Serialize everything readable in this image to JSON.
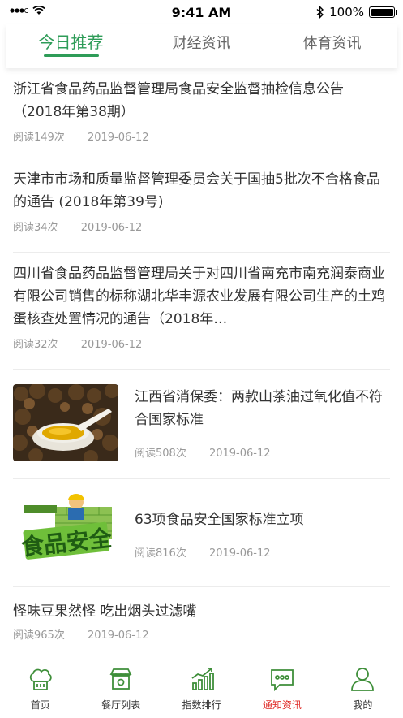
{
  "status": {
    "time": "9:41 AM",
    "battery": "100%"
  },
  "tabs": [
    {
      "label": "今日推荐"
    },
    {
      "label": "财经资讯"
    },
    {
      "label": "体育资讯"
    }
  ],
  "articles": [
    {
      "title": "浙江省食品药品监督管理局食品安全监督抽检信息公告（2018年第38期）",
      "reads": "阅读149次",
      "date": "2019-06-12"
    },
    {
      "title": "天津市市场和质量监督管理委员会关于国抽5批次不合格食品的通告 (2018年第39号)",
      "reads": "阅读34次",
      "date": "2019-06-12"
    },
    {
      "title": "四川省食品药品监督管理局关于对四川省南充市南充润泰商业有限公司销售的标称湖北华丰源农业发展有限公司生产的土鸡蛋核查处置情况的通告（2018年…",
      "reads": "阅读32次",
      "date": "2019-06-12"
    },
    {
      "title": "江西省消保委：两款山茶油过氧化值不符合国家标准",
      "reads": "阅读508次",
      "date": "2019-06-12"
    },
    {
      "title": "63项食品安全国家标准立项",
      "reads": "阅读816次",
      "date": "2019-06-12",
      "image_text": "食品安全"
    },
    {
      "title": "怪味豆果然怪 吃出烟头过滤嘴",
      "reads": "阅读965次",
      "date": "2019-06-12"
    }
  ],
  "tabbar": [
    {
      "label": "首页",
      "icon": "chef-hat-icon"
    },
    {
      "label": "餐厅列表",
      "icon": "restaurant-icon"
    },
    {
      "label": "指数排行",
      "icon": "chart-icon"
    },
    {
      "label": "通知资讯",
      "icon": "message-icon"
    },
    {
      "label": "我的",
      "icon": "user-icon"
    }
  ],
  "colors": {
    "accent": "#2e9c58",
    "active_tabbar": "#e0322e"
  }
}
